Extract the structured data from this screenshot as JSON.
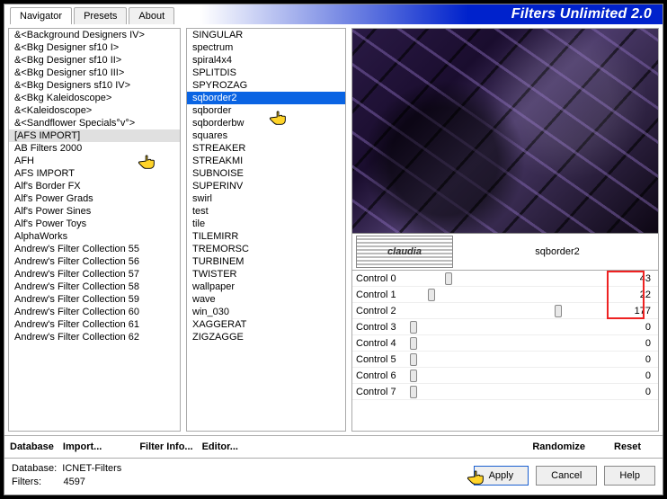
{
  "app_title": "Filters Unlimited 2.0",
  "tabs": [
    {
      "label": "Navigator",
      "active": true
    },
    {
      "label": "Presets",
      "active": false
    },
    {
      "label": "About",
      "active": false
    }
  ],
  "list1": [
    "&<Background Designers IV>",
    "&<Bkg Designer sf10 I>",
    "&<Bkg Designer sf10 II>",
    "&<Bkg Designer sf10 III>",
    "&<Bkg Designers sf10 IV>",
    "&<Bkg Kaleidoscope>",
    "&<Kaleidoscope>",
    "&<Sandflower Specials°v°>",
    "[AFS IMPORT]",
    "AB Filters 2000",
    "AFH",
    "AFS IMPORT",
    "Alf's Border FX",
    "Alf's Power Grads",
    "Alf's Power Sines",
    "Alf's Power Toys",
    "AlphaWorks",
    "Andrew's Filter Collection 55",
    "Andrew's Filter Collection 56",
    "Andrew's Filter Collection 57",
    "Andrew's Filter Collection 58",
    "Andrew's Filter Collection 59",
    "Andrew's Filter Collection 60",
    "Andrew's Filter Collection 61",
    "Andrew's Filter Collection 62"
  ],
  "list1_selected_index": 8,
  "list2": [
    "SINGULAR",
    "spectrum",
    "spiral4x4",
    "SPLITDIS",
    "SPYROZAG",
    "sqborder2",
    "sqborder",
    "sqborderbw",
    "squares",
    "STREAKER",
    "STREAKMI",
    "SUBNOISE",
    "SUPERINV",
    "swirl",
    "test",
    "tile",
    "TILEMIRR",
    "TREMORSC",
    "TURBINEM",
    "TWISTER",
    "wallpaper",
    "wave",
    "win_030",
    "XAGGERAT",
    "ZIGZAGGE"
  ],
  "list2_selected_index": 5,
  "watermark_text": "claudia",
  "preview_filter_name": "sqborder2",
  "controls": [
    {
      "label": "Control 0",
      "value": 43
    },
    {
      "label": "Control 1",
      "value": 22
    },
    {
      "label": "Control 2",
      "value": 177
    },
    {
      "label": "Control 3",
      "value": 0
    },
    {
      "label": "Control 4",
      "value": 0
    },
    {
      "label": "Control 5",
      "value": 0
    },
    {
      "label": "Control 6",
      "value": 0
    },
    {
      "label": "Control 7",
      "value": 0
    }
  ],
  "control_max": 255,
  "toolbar": {
    "database": "Database",
    "import": "Import...",
    "filter_info": "Filter Info...",
    "editor": "Editor...",
    "randomize": "Randomize",
    "reset": "Reset"
  },
  "status": {
    "db_label": "Database:",
    "db_value": "ICNET-Filters",
    "filters_label": "Filters:",
    "filters_value": "4597"
  },
  "buttons": {
    "apply": "Apply",
    "cancel": "Cancel",
    "help": "Help"
  },
  "highlight_controls_count": 3
}
